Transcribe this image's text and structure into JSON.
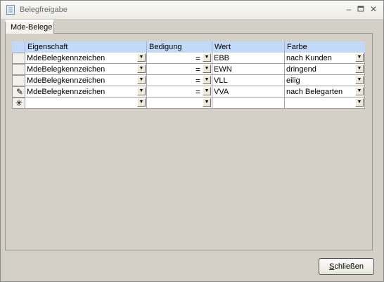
{
  "window": {
    "title": "Belegfreigabe"
  },
  "tabs": [
    {
      "label": "Mde-Belege"
    }
  ],
  "grid": {
    "columns": [
      "Eigenschaft",
      "Bedigung",
      "Wert",
      "Farbe"
    ],
    "rows": [
      {
        "eigenschaft": "MdeBelegkennzeichen",
        "bedingung": "=",
        "wert": "EBB",
        "farbe": "nach Kunden"
      },
      {
        "eigenschaft": "MdeBelegkennzeichen",
        "bedingung": "=",
        "wert": "EWN",
        "farbe": "dringend"
      },
      {
        "eigenschaft": "MdeBelegkennzeichen",
        "bedingung": "=",
        "wert": "VLL",
        "farbe": "eilig"
      },
      {
        "eigenschaft": "MdeBelegkennzeichen",
        "bedingung": "=",
        "wert": "VVA",
        "farbe": "nach Belegarten"
      }
    ],
    "new_row_indicator": "✳",
    "edit_indicator": "✎"
  },
  "buttons": {
    "close_label_prefix": "",
    "close_label_hotkey": "S",
    "close_label_rest": "chließen"
  },
  "icons": {
    "minimize": "minimize-icon",
    "maximize": "maximize-icon",
    "close": "close-icon",
    "dropdown": "chevron-down-icon"
  }
}
